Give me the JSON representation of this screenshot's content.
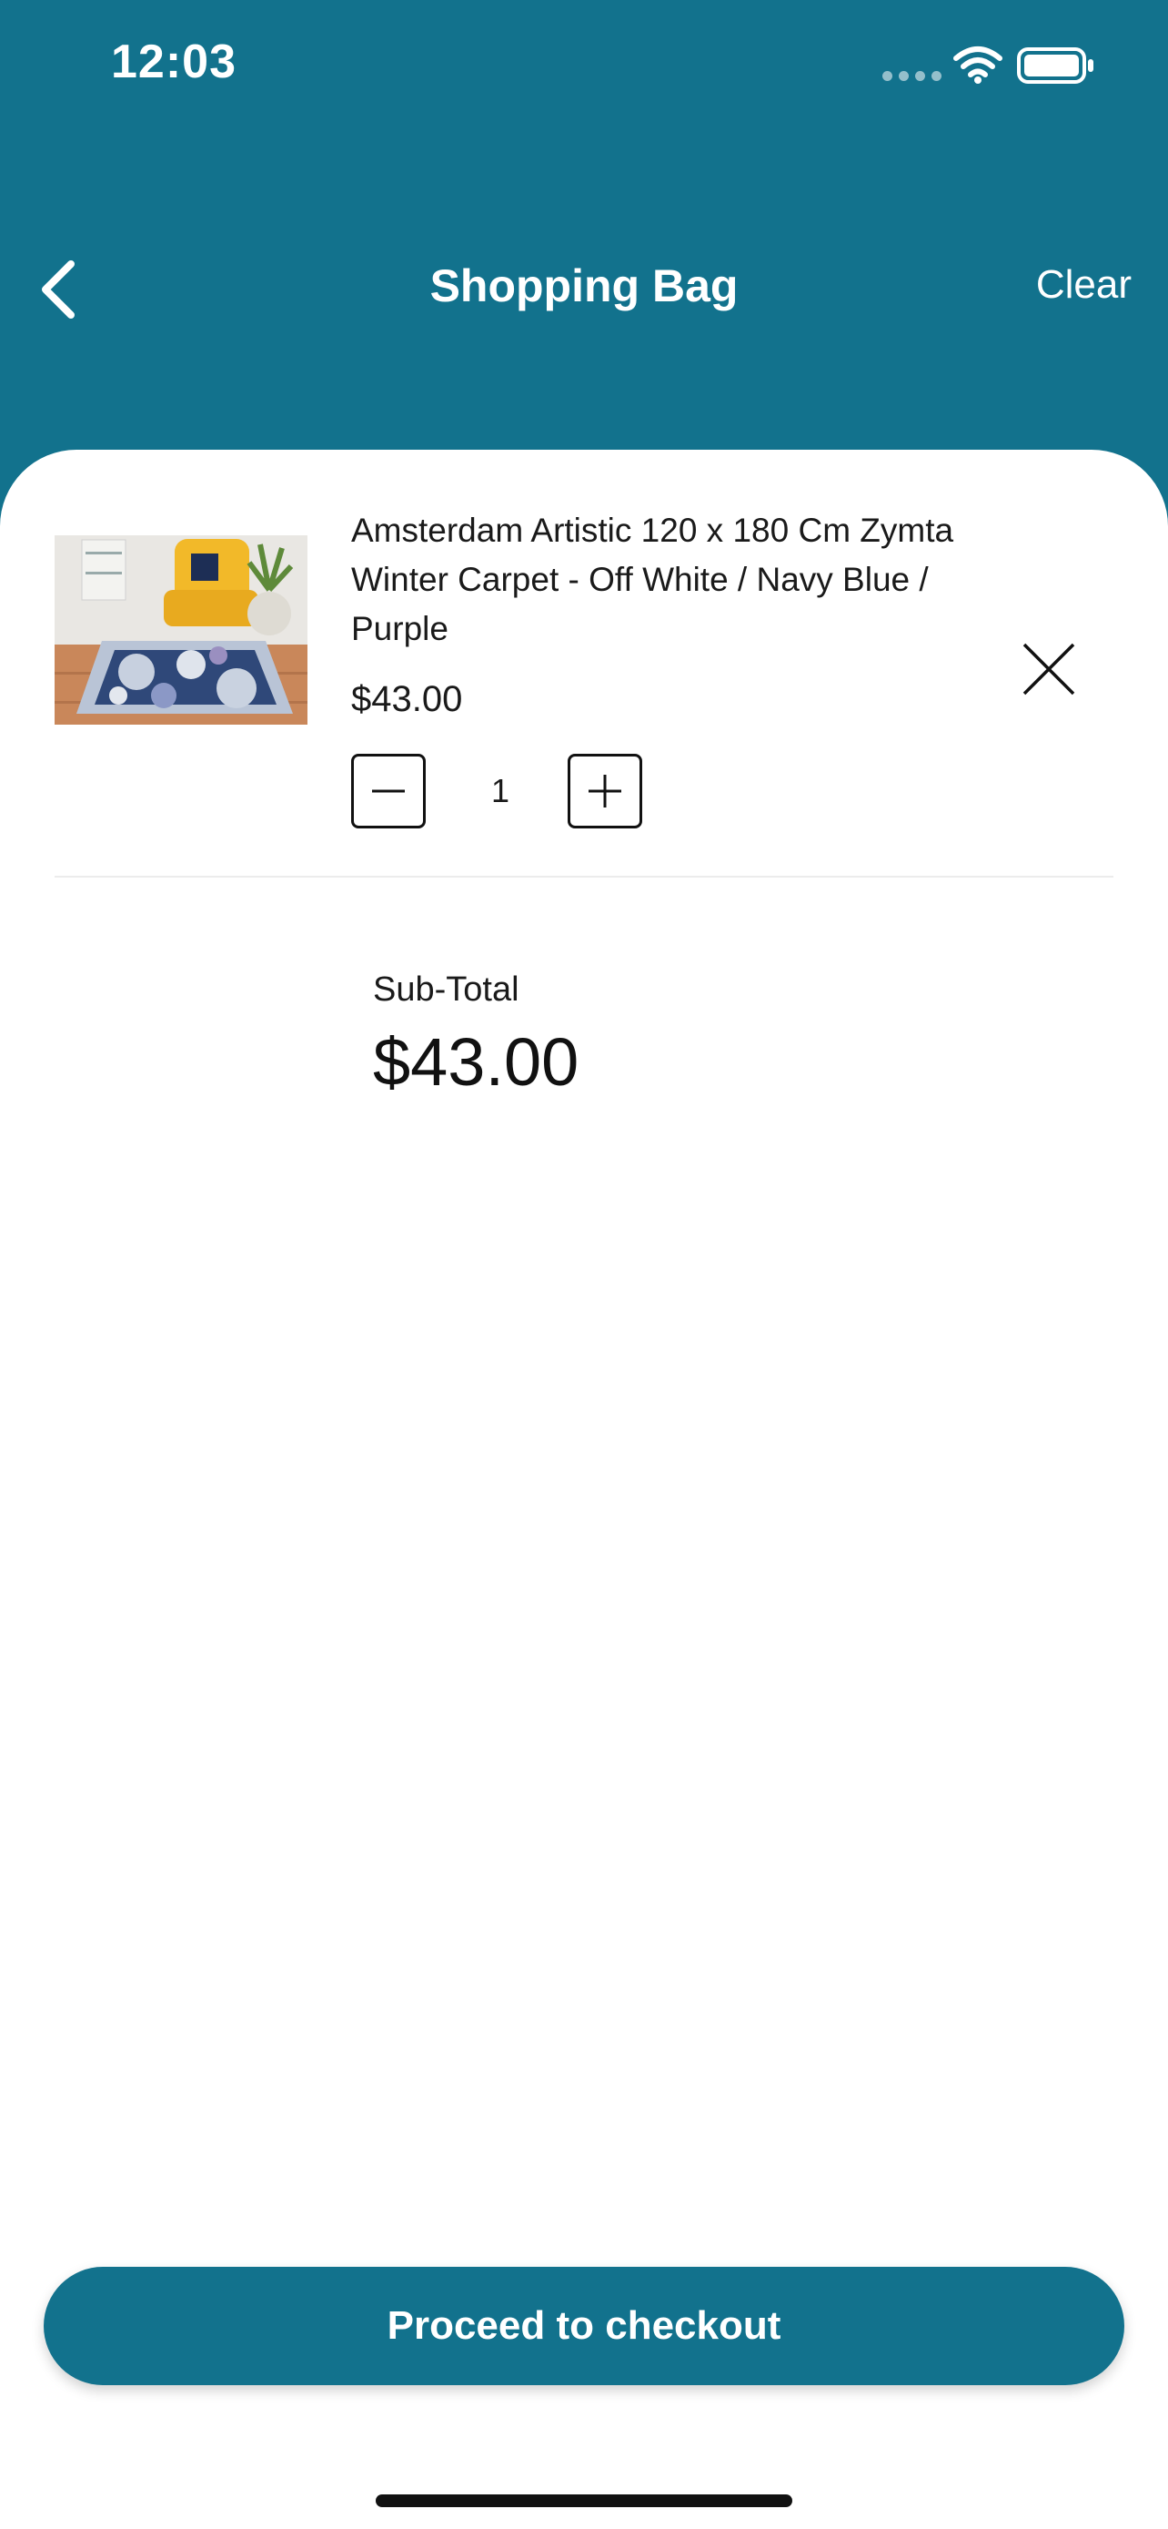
{
  "status_bar": {
    "time": "12:03"
  },
  "header": {
    "title": "Shopping Bag",
    "clear_label": "Clear",
    "color": "#12728d"
  },
  "cart": {
    "items": [
      {
        "name": "Amsterdam Artistic 120 x 180 Cm Zymta Winter Carpet - Off White / Navy Blue / Purple",
        "price": "$43.00",
        "quantity": "1"
      }
    ]
  },
  "summary": {
    "subtotal_label": "Sub-Total",
    "subtotal_value": "$43.00"
  },
  "checkout": {
    "label": "Proceed to checkout"
  },
  "icons": [
    "back-icon",
    "close-icon",
    "minus-icon",
    "plus-icon",
    "wifi-icon",
    "battery-icon",
    "signal-icon"
  ]
}
